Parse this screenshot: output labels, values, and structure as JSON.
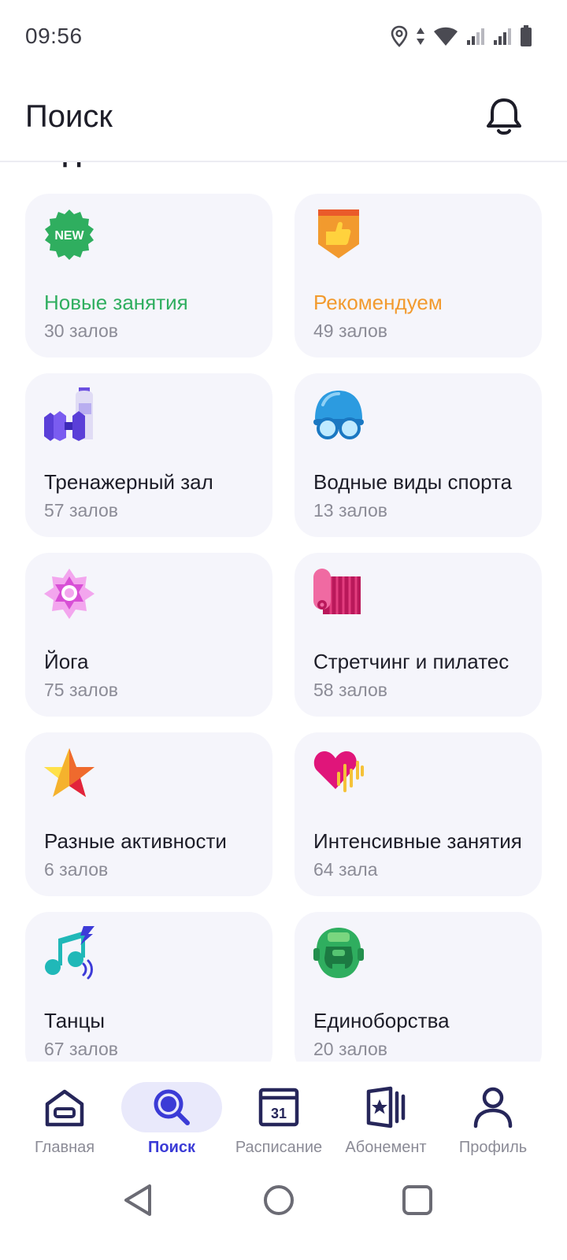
{
  "status_bar": {
    "time": "09:56",
    "icons": [
      "location-icon",
      "data-arrows-icon",
      "wifi-icon",
      "signal-icon",
      "signal-icon",
      "battery-icon"
    ]
  },
  "header": {
    "title": "Поиск",
    "bell_icon": "bell-icon"
  },
  "section": {
    "title": "Виды занятий"
  },
  "cards": [
    {
      "name": "Новые занятия",
      "count": "30 залов",
      "icon": "new-badge-icon",
      "name_color": "#2fae5f"
    },
    {
      "name": "Рекомендуем",
      "count": "49 залов",
      "icon": "thumbs-up-icon",
      "name_color": "#f29a2e"
    },
    {
      "name": "Тренажерный зал",
      "count": "57 залов",
      "icon": "dumbbell-icon",
      "name_color": "#1d1d28"
    },
    {
      "name": "Водные виды спорта",
      "count": "13 залов",
      "icon": "swim-cap-icon",
      "name_color": "#1d1d28"
    },
    {
      "name": "Йога",
      "count": "75 залов",
      "icon": "lotus-icon",
      "name_color": "#1d1d28"
    },
    {
      "name": "Стретчинг и пилатес",
      "count": "58 залов",
      "icon": "yoga-mat-icon",
      "name_color": "#1d1d28"
    },
    {
      "name": "Разные активности",
      "count": "6 залов",
      "icon": "star-icon",
      "name_color": "#1d1d28"
    },
    {
      "name": "Интенсивные занятия",
      "count": "64 зала",
      "icon": "heart-pulse-icon",
      "name_color": "#1d1d28"
    },
    {
      "name": "Танцы",
      "count": "67 залов",
      "icon": "music-note-icon",
      "name_color": "#1d1d28"
    },
    {
      "name": "Единоборства",
      "count": "20 залов",
      "icon": "boxing-helmet-icon",
      "name_color": "#1d1d28"
    }
  ],
  "bottom_nav": [
    {
      "label": "Главная",
      "icon": "home-icon",
      "active": false
    },
    {
      "label": "Поиск",
      "icon": "search-icon",
      "active": true
    },
    {
      "label": "Расписание",
      "icon": "calendar-icon",
      "active": false,
      "icon_text": "31"
    },
    {
      "label": "Абонемент",
      "icon": "membership-card-icon",
      "active": false
    },
    {
      "label": "Профиль",
      "icon": "profile-icon",
      "active": false
    }
  ],
  "colors": {
    "accent": "#3b3bd6",
    "card_bg": "#f5f5fb",
    "muted_text": "#8b8b96"
  }
}
